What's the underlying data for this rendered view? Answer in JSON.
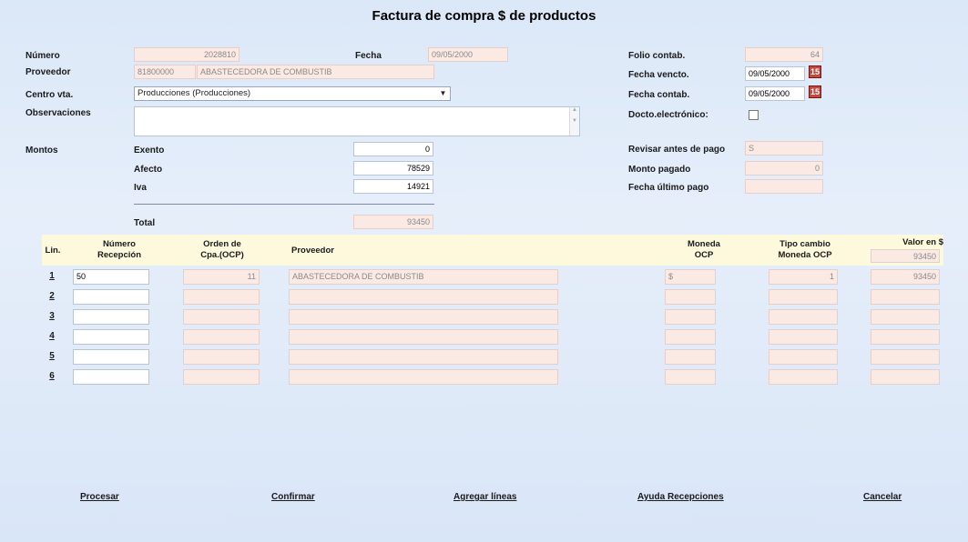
{
  "window_title": "Factura de compra $ de productos",
  "header": {
    "numero": {
      "label": "Número",
      "value": "2028810"
    },
    "fecha": {
      "label": "Fecha",
      "value": "09/05/2000"
    },
    "proveedor": {
      "label": "Proveedor",
      "code": "81800000",
      "name": "ABASTECEDORA DE COMBUSTIB"
    },
    "centro": {
      "label": "Centro vta.",
      "selected": "Producciones (Producciones)"
    },
    "observaciones": {
      "label": "Observaciones",
      "value": ""
    },
    "folio": {
      "label": "Folio contab.",
      "value": "64"
    },
    "fecha_vencto": {
      "label": "Fecha vencto.",
      "value": "09/05/2000"
    },
    "fecha_contab": {
      "label": "Fecha contab.",
      "value": "09/05/2000"
    },
    "docto_electronico": {
      "label": "Docto.electrónico:",
      "checked": false
    },
    "revisar": {
      "label": "Revisar antes de pago",
      "value": "S"
    },
    "monto_pagado": {
      "label": "Monto pagado",
      "value": "0"
    },
    "fecha_ultimo_pago": {
      "label": "Fecha último pago",
      "value": ""
    }
  },
  "montos": {
    "label": "Montos",
    "exento": {
      "label": "Exento",
      "value": "0"
    },
    "afecto": {
      "label": "Afecto",
      "value": "78529"
    },
    "iva": {
      "label": "Iva",
      "value": "14921"
    },
    "total": {
      "label": "Total",
      "value": "93450"
    }
  },
  "grid": {
    "headers": {
      "lin": "Lin.",
      "numero": "Número\nRecepción",
      "orden": "Orden de\nCpa.(OCP)",
      "proveedor": "Proveedor",
      "moneda": "Moneda\nOCP",
      "tipo_cambio": "Tipo cambio\nMoneda OCP",
      "valor": "Valor en $"
    },
    "valor_total": "93450",
    "rows": [
      {
        "lin": "1",
        "numero": "50",
        "orden": "11",
        "proveedor": "ABASTECEDORA DE COMBUSTIB",
        "moneda": "$",
        "tipo_cambio": "1",
        "valor": "93450"
      },
      {
        "lin": "2",
        "numero": "",
        "orden": "",
        "proveedor": "",
        "moneda": "",
        "tipo_cambio": "",
        "valor": ""
      },
      {
        "lin": "3",
        "numero": "",
        "orden": "",
        "proveedor": "",
        "moneda": "",
        "tipo_cambio": "",
        "valor": ""
      },
      {
        "lin": "4",
        "numero": "",
        "orden": "",
        "proveedor": "",
        "moneda": "",
        "tipo_cambio": "",
        "valor": ""
      },
      {
        "lin": "5",
        "numero": "",
        "orden": "",
        "proveedor": "",
        "moneda": "",
        "tipo_cambio": "",
        "valor": ""
      },
      {
        "lin": "6",
        "numero": "",
        "orden": "",
        "proveedor": "",
        "moneda": "",
        "tipo_cambio": "",
        "valor": ""
      }
    ]
  },
  "actions": {
    "procesar": "Procesar",
    "confirmar": "Confirmar",
    "agregar": "Agregar líneas",
    "ayuda": "Ayuda Recepciones",
    "cancelar": "Cancelar"
  },
  "icons": {
    "calendar": "calendar-icon",
    "dropdown": "chevron-down-icon"
  }
}
